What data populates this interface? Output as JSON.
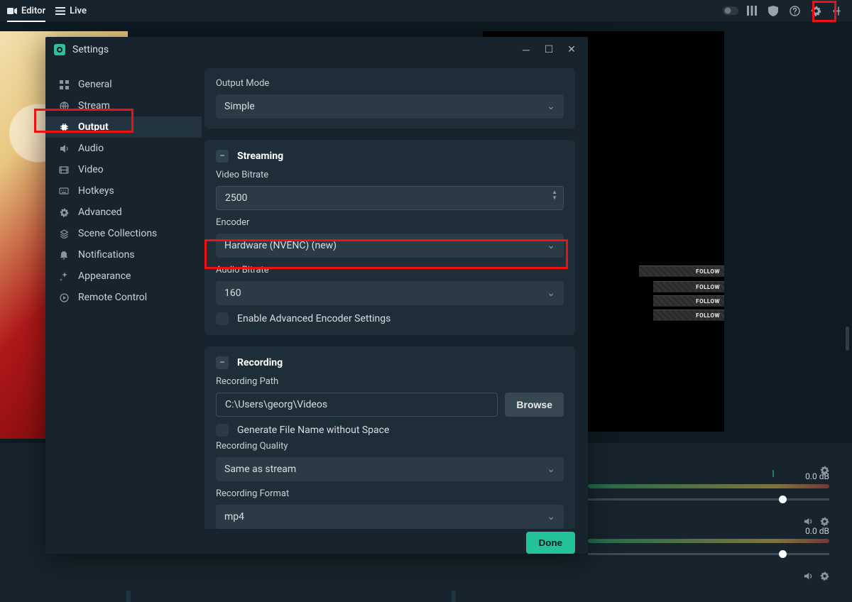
{
  "topbar": {
    "editor": "Editor",
    "live": "Live"
  },
  "followLabel": "FOLLOW",
  "mixer": {
    "db1": "0.0 dB",
    "db2": "0.0 dB"
  },
  "dialog": {
    "title": "Settings",
    "sidebar": [
      "General",
      "Stream",
      "Output",
      "Audio",
      "Video",
      "Hotkeys",
      "Advanced",
      "Scene Collections",
      "Notifications",
      "Appearance",
      "Remote Control"
    ],
    "outputMode": {
      "label": "Output Mode",
      "value": "Simple"
    },
    "streaming": {
      "title": "Streaming",
      "videoBitrate": {
        "label": "Video Bitrate",
        "value": "2500"
      },
      "encoder": {
        "label": "Encoder",
        "value": "Hardware (NVENC) (new)"
      },
      "audioBitrate": {
        "label": "Audio Bitrate",
        "value": "160"
      },
      "advancedToggle": "Enable Advanced Encoder Settings"
    },
    "recording": {
      "title": "Recording",
      "path": {
        "label": "Recording Path",
        "value": "C:\\Users\\georg\\Videos",
        "browse": "Browse"
      },
      "noSpace": "Generate File Name without Space",
      "quality": {
        "label": "Recording Quality",
        "value": "Same as stream"
      },
      "format": {
        "label": "Recording Format",
        "value": "mp4"
      }
    },
    "done": "Done"
  }
}
